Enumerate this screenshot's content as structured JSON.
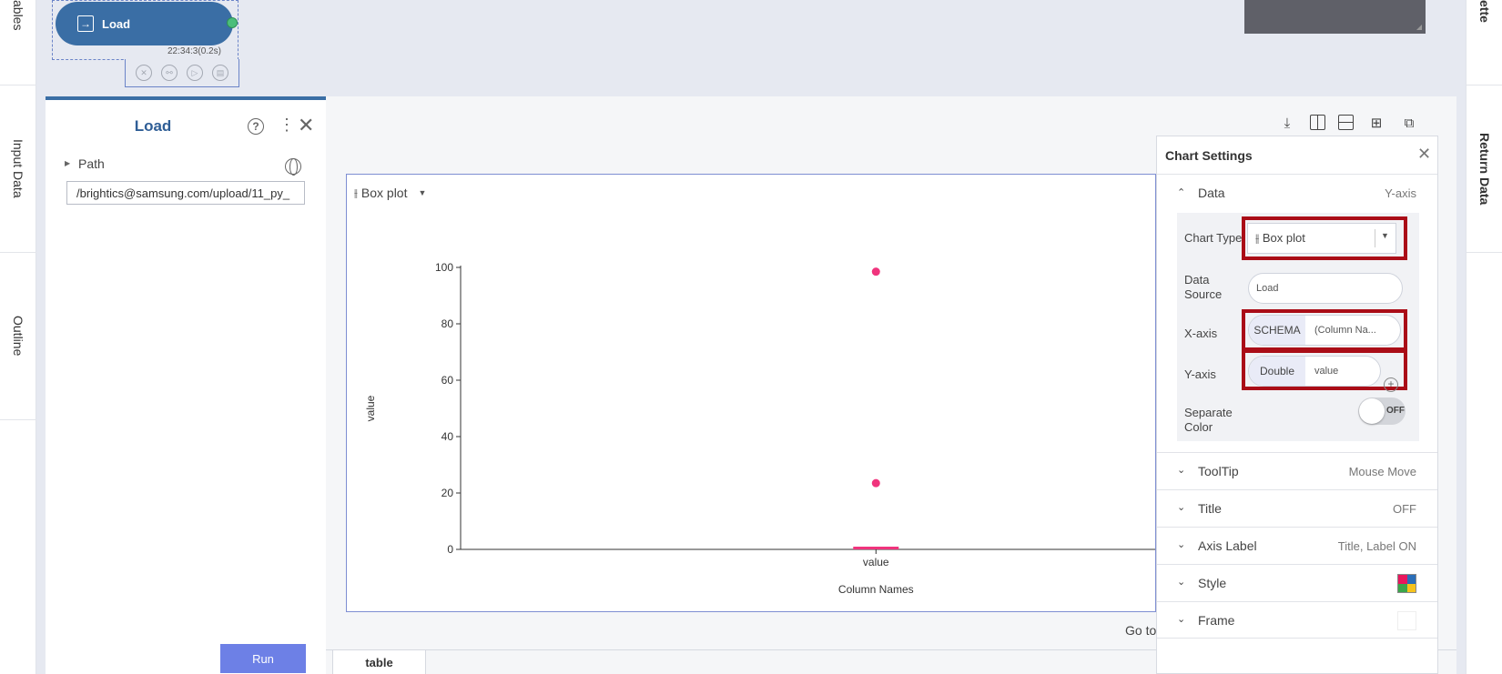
{
  "left_tabs": [
    "ables",
    "Input Data",
    "Outline"
  ],
  "right_tabs": [
    "ette",
    "Return Data"
  ],
  "node": {
    "label": "Load",
    "time": "22:34:3(0.2s)"
  },
  "props": {
    "title": "Load",
    "path_label": "Path",
    "path_value": "/brightics@samsung.com/upload/11_py_",
    "run_label": "Run"
  },
  "chart": {
    "type_label": "Box plot",
    "goto_text": "Go to",
    "bottom_tab": "table"
  },
  "chart_data": {
    "type": "box",
    "categories": [
      "value"
    ],
    "outliers": [
      {
        "x": "value",
        "y": 98.5
      },
      {
        "x": "value",
        "y": 23.5
      }
    ],
    "box": {
      "x": "value",
      "q1": 0,
      "median": 0.3,
      "q3": 0.7
    },
    "xlabel": "Column Names",
    "ylabel": "value",
    "ylim": [
      0,
      100
    ],
    "yticks": [
      "0",
      "20",
      "40",
      "60",
      "80",
      "100"
    ],
    "marker_color": "#f0347d"
  },
  "settings": {
    "title": "Chart Settings",
    "data_section": {
      "label": "Data",
      "value": "Y-axis"
    },
    "chart_type_label": "Chart Type",
    "chart_type_value": "Box plot",
    "data_source_label": "Data Source",
    "data_source_value": "Load",
    "x_axis_label": "X-axis",
    "x_axis_tag": "SCHEMA",
    "x_axis_value": "(Column Na...",
    "y_axis_label": "Y-axis",
    "y_axis_tag": "Double",
    "y_axis_value": "value",
    "separate_color_label": "Separate Color",
    "toggle_state": "OFF",
    "sections": [
      {
        "label": "ToolTip",
        "value": "Mouse Move"
      },
      {
        "label": "Title",
        "value": "OFF"
      },
      {
        "label": "Axis Label",
        "value": "Title, Label ON"
      },
      {
        "label": "Style",
        "value": ""
      },
      {
        "label": "Frame",
        "value": ""
      }
    ]
  },
  "colors": {
    "accent": "#3a6ea5",
    "highlight": "#aa0d17",
    "run": "#6d80e6"
  },
  "icons": [
    "load-icon",
    "cancel-icon",
    "connect-icon",
    "play-icon",
    "clipboard-icon",
    "help-icon",
    "kebab-icon",
    "close-icon",
    "globe-icon",
    "download-icon",
    "split-vertical-icon",
    "split-horizontal-icon",
    "grid-icon",
    "popout-icon"
  ]
}
